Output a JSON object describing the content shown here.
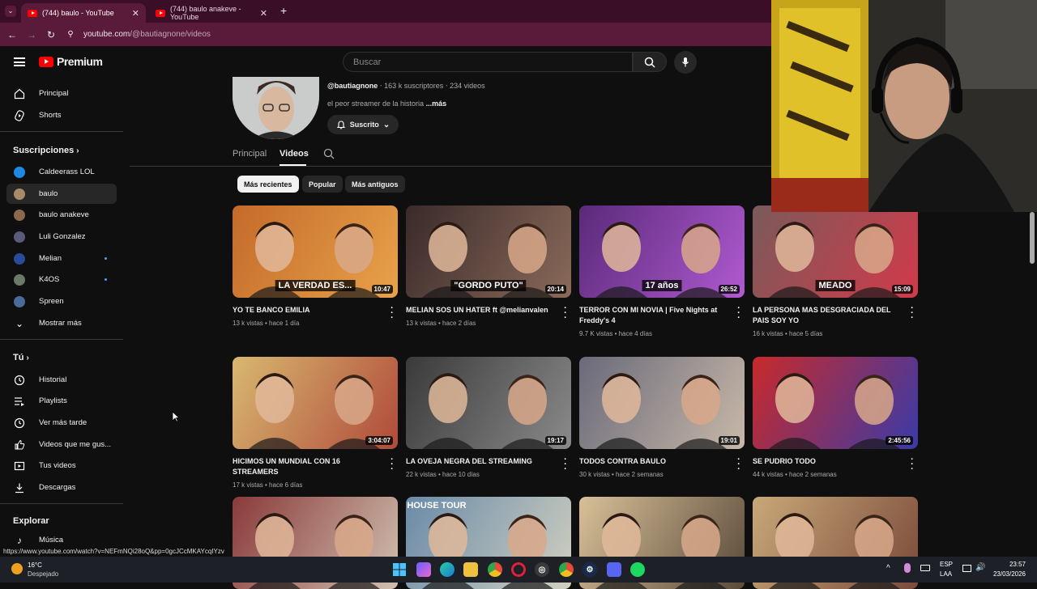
{
  "browser": {
    "tabs": [
      {
        "title": "(744) baulo - YouTube",
        "close": "✕"
      },
      {
        "title": "(744) baulo anakeve - YouTube",
        "close": "✕"
      }
    ],
    "new_tab": "+",
    "url_host": "youtube.com",
    "url_path": "/@bautiagnone/videos"
  },
  "header": {
    "logo_text": "Premium",
    "search_placeholder": "Buscar"
  },
  "sidebar": {
    "main": [
      {
        "label": "Principal",
        "icon": "home-icon"
      },
      {
        "label": "Shorts",
        "icon": "shorts-icon"
      }
    ],
    "subs_heading": "Suscripciones",
    "subs": [
      {
        "label": "Caldeerass LOL",
        "color": "#1e88e5",
        "dot": false
      },
      {
        "label": "baulo",
        "color": "#a88a6a",
        "dot": false,
        "selected": true
      },
      {
        "label": "baulo anakeve",
        "color": "#8a6a4a",
        "dot": false
      },
      {
        "label": "Luli Gonzalez",
        "color": "#5a5a7a",
        "dot": false
      },
      {
        "label": "Melian",
        "color": "#2a4a9a",
        "dot": true
      },
      {
        "label": "K4OS",
        "color": "#6a7a6a",
        "dot": true
      },
      {
        "label": "Spreen",
        "color": "#4a6a9a",
        "dot": false
      }
    ],
    "show_more": "Mostrar más",
    "you_heading": "Tú",
    "you": [
      {
        "label": "Historial",
        "icon": "history-icon"
      },
      {
        "label": "Playlists",
        "icon": "playlists-icon"
      },
      {
        "label": "Ver más tarde",
        "icon": "watch-later-icon"
      },
      {
        "label": "Videos que me gus...",
        "icon": "liked-icon"
      },
      {
        "label": "Tus videos",
        "icon": "your-videos-icon"
      },
      {
        "label": "Descargas",
        "icon": "downloads-icon"
      }
    ],
    "explore_heading": "Explorar",
    "explore": [
      {
        "label": "Música",
        "icon": "music-icon"
      }
    ]
  },
  "channel": {
    "handle": "@bautiagnone",
    "subscribers": "163 k suscriptores",
    "video_count": "234 videos",
    "description": "el peor streamer de la historia",
    "more": "...más",
    "subscribed_label": "Suscrito",
    "tabs": [
      "Principal",
      "Videos"
    ],
    "chips": [
      "Más recientes",
      "Popular",
      "Más antiguos"
    ]
  },
  "videos": [
    {
      "title": "YO TE BANCO EMILIA",
      "views": "13 k vistas",
      "age": "hace 1 día",
      "duration": "10:47",
      "bg": [
        "#c46a2a",
        "#e8a24a"
      ],
      "caption": "LA VERDAD ES..."
    },
    {
      "title": "MELIAN SOS UN HATER ft @melianvalen",
      "views": "13 k vistas",
      "age": "hace 2 días",
      "duration": "20:14",
      "bg": [
        "#3a2a2a",
        "#8a6a5a"
      ],
      "caption": "\"GORDO PUTO\""
    },
    {
      "title": "TERROR CON MI NOVIA | Five Nights at Freddy's 4",
      "views": "9.7 K vistas",
      "age": "hace 4 días",
      "duration": "26:52",
      "bg": [
        "#5a2a7a",
        "#b05ad0"
      ],
      "caption": "17 años"
    },
    {
      "title": "LA PERSONA MAS DESGRACIADA DEL PAIS SOY YO",
      "views": "16 k vistas",
      "age": "hace 5 días",
      "duration": "15:09",
      "bg": [
        "#7a5a5a",
        "#d23a4a"
      ],
      "caption": "MEADO"
    },
    {
      "title": "HICIMOS UN MUNDIAL CON 16 STREAMERS",
      "views": "17 k vistas",
      "age": "hace 6 días",
      "duration": "3:04:07",
      "bg": [
        "#d8b870",
        "#b04a3a"
      ],
      "caption": ""
    },
    {
      "title": "LA OVEJA NEGRA DEL STREAMING",
      "views": "22 k vistas",
      "age": "hace 10 días",
      "duration": "19:17",
      "bg": [
        "#3a3a3a",
        "#8a8a8a"
      ],
      "caption": ""
    },
    {
      "title": "TODOS CONTRA BAULO",
      "views": "30 k vistas",
      "age": "hace 2 semanas",
      "duration": "19:01",
      "bg": [
        "#6a6a7a",
        "#c8b8a8"
      ],
      "caption": ""
    },
    {
      "title": "SE PUDRIO TODO",
      "views": "44 k vistas",
      "age": "hace 2 semanas",
      "duration": "2:45:56",
      "bg": [
        "#c82a2a",
        "#3a3aa8"
      ],
      "caption": ""
    },
    {
      "title": "",
      "views": "",
      "age": "",
      "duration": "",
      "bg": [
        "#8a3a3a",
        "#d0c0b0"
      ],
      "caption": ""
    },
    {
      "title": "",
      "views": "",
      "age": "",
      "duration": "",
      "bg": [
        "#6a8aa8",
        "#d0d0c0"
      ],
      "caption": "HOUSE TOUR"
    },
    {
      "title": "",
      "views": "",
      "age": "",
      "duration": "",
      "bg": [
        "#d8c098",
        "#5a4a3a"
      ],
      "caption": ""
    },
    {
      "title": "",
      "views": "",
      "age": "",
      "duration": "",
      "bg": [
        "#c8a878",
        "#7a4a3a"
      ],
      "caption": ""
    }
  ],
  "status_url": "https://www.youtube.com/watch?v=NEFmNQi28oQ&pp=0gcJCcMKAYcqIYzv",
  "taskbar": {
    "weather_temp": "16°C",
    "weather_text": "Despejado",
    "lang": "ESP",
    "lang2": "LAA",
    "time": "23:57",
    "date": "23/03/2026"
  },
  "colors": {
    "accent": "#ff0000",
    "tabbar": "#3a0e27",
    "addressbar": "#5a1a3a"
  }
}
